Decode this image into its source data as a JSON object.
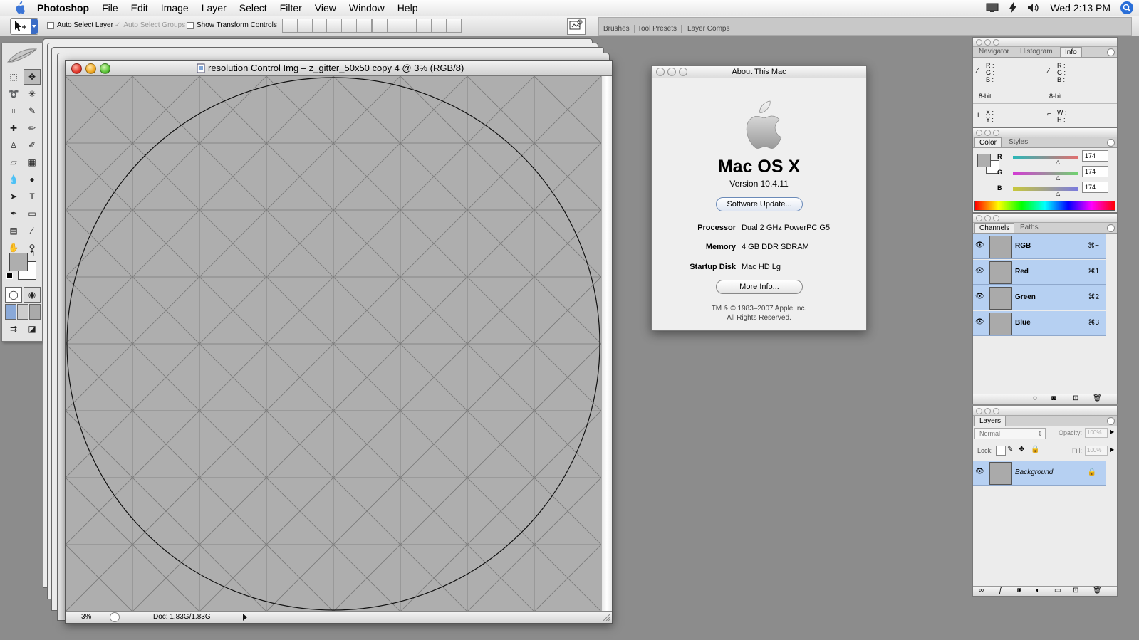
{
  "menubar": {
    "app": "Photoshop",
    "items": [
      "File",
      "Edit",
      "Image",
      "Layer",
      "Select",
      "Filter",
      "View",
      "Window",
      "Help"
    ],
    "clock": "Wed 2:13 PM"
  },
  "options_bar": {
    "auto_select_layer": "Auto Select Layer",
    "auto_select_groups": "Auto Select Groups",
    "show_transform_controls": "Show Transform Controls",
    "well_tabs": [
      "Brushes",
      "Tool Presets",
      "Layer Comps"
    ]
  },
  "document": {
    "title": "resolution Control Img – z_gitter_50x50 copy 4 @ 3% (RGB/8)",
    "zoom": "3%",
    "doc_size": "Doc: 1.83G/1.83G"
  },
  "about": {
    "title": "About This Mac",
    "os_name": "Mac OS X",
    "version": "Version 10.4.11",
    "software_update": "Software Update...",
    "rows": [
      {
        "key": "Processor",
        "value": "Dual 2 GHz PowerPC G5"
      },
      {
        "key": "Memory",
        "value": "4 GB DDR SDRAM"
      },
      {
        "key": "Startup Disk",
        "value": "Mac HD Lg"
      }
    ],
    "more_info": "More Info...",
    "copyright_1": "TM & © 1983–2007 Apple Inc.",
    "copyright_2": "All Rights Reserved."
  },
  "info_palette": {
    "tabs": [
      "Navigator",
      "Histogram",
      "Info"
    ],
    "r": "R :",
    "g": "G :",
    "b": "B :",
    "bit_left": "8-bit",
    "bit_right": "8-bit",
    "x": "X :",
    "y": "Y :",
    "w": "W :",
    "h": "H :"
  },
  "color_palette": {
    "tabs": [
      "Color",
      "Styles"
    ],
    "r_label": "R",
    "g_label": "G",
    "b_label": "B",
    "r_value": "174",
    "g_value": "174",
    "b_value": "174",
    "fg_color": "#aeaeae"
  },
  "channels_palette": {
    "tabs": [
      "Channels",
      "Paths"
    ],
    "channels": [
      {
        "name": "RGB",
        "shortcut": "⌘~"
      },
      {
        "name": "Red",
        "shortcut": "⌘1"
      },
      {
        "name": "Green",
        "shortcut": "⌘2"
      },
      {
        "name": "Blue",
        "shortcut": "⌘3"
      }
    ]
  },
  "layers_palette": {
    "tab": "Layers",
    "blend_mode": "Normal",
    "opacity_label": "Opacity:",
    "opacity_value": "100%",
    "lock_label": "Lock:",
    "fill_label": "Fill:",
    "fill_value": "100%",
    "layer_name": "Background"
  },
  "colors": {
    "selection_blue": "#b6d0f2",
    "desktop_gray": "#8c8c8c",
    "canvas_gray": "#aeaeae"
  }
}
